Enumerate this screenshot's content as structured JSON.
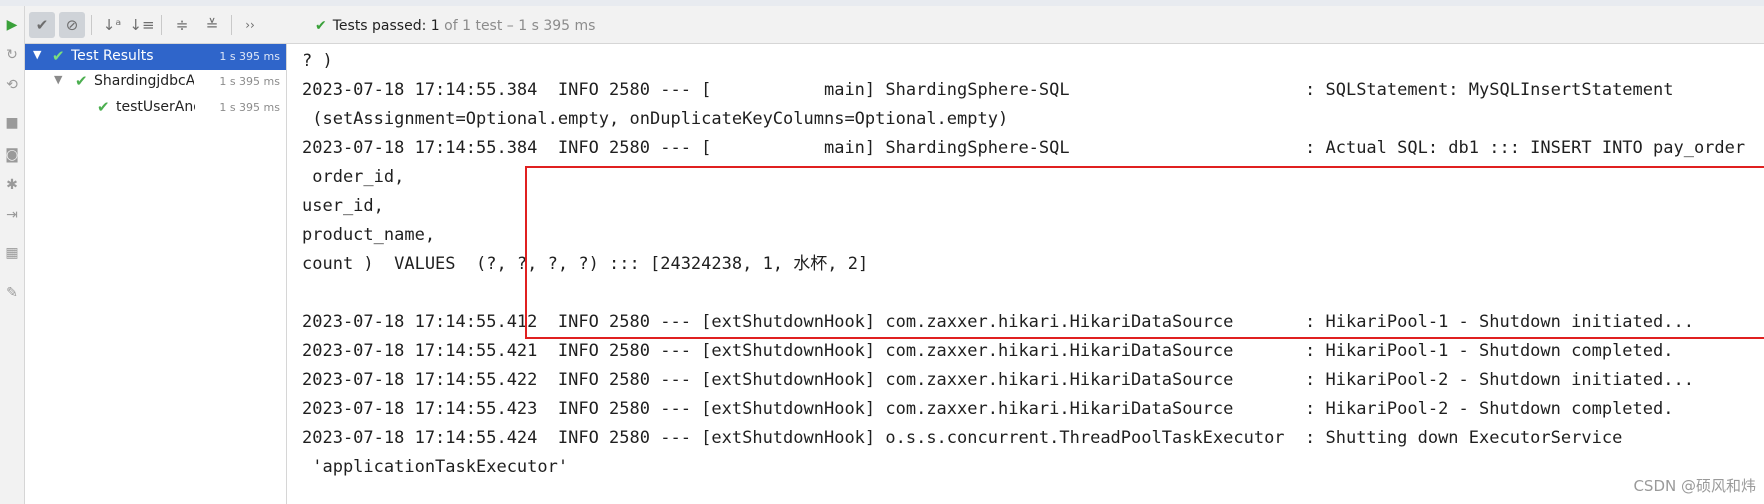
{
  "toolbar": {
    "status_label": "Tests passed:",
    "status_count": "1",
    "status_meta": "of 1 test – 1 s 395 ms",
    "icons": [
      "run-icon",
      "show-passed-icon",
      "show-ignored-icon",
      "sort-alpha-icon",
      "sort-duration-icon",
      "expand-all-icon",
      "collapse-all-icon",
      "more-icon"
    ]
  },
  "tree": {
    "items": [
      {
        "label": "Test Results",
        "duration": "1 s 395 ms"
      },
      {
        "label": "ShardingjdbcApp",
        "duration": "1 s 395 ms"
      },
      {
        "label": "testUserAndP",
        "duration": "1 s 395 ms"
      }
    ]
  },
  "console": {
    "lines": [
      "? )",
      "2023-07-18 17:14:55.384  INFO 2580 --- [           main] ShardingSphere-SQL                       : SQLStatement: MySQLInsertStatement",
      " (setAssignment=Optional.empty, onDuplicateKeyColumns=Optional.empty)",
      "2023-07-18 17:14:55.384  INFO 2580 --- [           main] ShardingSphere-SQL                       : Actual SQL: db1 ::: INSERT INTO pay_order  (",
      " order_id,",
      "user_id,",
      "product_name,",
      "count )  VALUES  (?, ?, ?, ?) ::: [24324238, 1, 水杯, 2]",
      "",
      "2023-07-18 17:14:55.412  INFO 2580 --- [extShutdownHook] com.zaxxer.hikari.HikariDataSource       : HikariPool-1 - Shutdown initiated...",
      "2023-07-18 17:14:55.421  INFO 2580 --- [extShutdownHook] com.zaxxer.hikari.HikariDataSource       : HikariPool-1 - Shutdown completed.",
      "2023-07-18 17:14:55.422  INFO 2580 --- [extShutdownHook] com.zaxxer.hikari.HikariDataSource       : HikariPool-2 - Shutdown initiated...",
      "2023-07-18 17:14:55.423  INFO 2580 --- [extShutdownHook] com.zaxxer.hikari.HikariDataSource       : HikariPool-2 - Shutdown completed.",
      "2023-07-18 17:14:55.424  INFO 2580 --- [extShutdownHook] o.s.s.concurrent.ThreadPoolTaskExecutor  : Shutting down ExecutorService",
      " 'applicationTaskExecutor'"
    ]
  },
  "watermark": "CSDN @硕风和炜",
  "colors": {
    "highlight_box": "#e02020",
    "selection": "#2f65ca",
    "pass": "#4caf50"
  }
}
